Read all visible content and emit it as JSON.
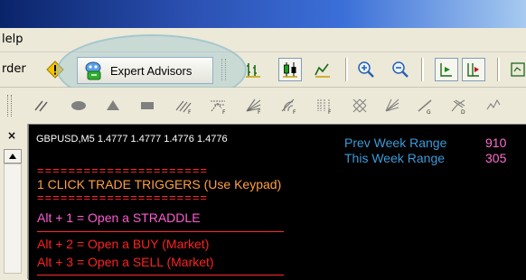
{
  "menu": {
    "help_label": "lelp"
  },
  "toolbar": {
    "order_label": "rder",
    "expert_advisors_label": "Expert Advisors"
  },
  "chart": {
    "header": "GBPUSD,M5  1.4777 1.4777 1.4776 1.4776",
    "prev_week_label": "Prev Week Range",
    "prev_week_value": "910",
    "this_week_label": "This Week Range",
    "this_week_value": "305",
    "divider_text": "======================",
    "triggers_title": "1 CLICK TRADE TRIGGERS (Use Keypad)",
    "triggers": [
      {
        "text": "Alt + 1 = Open a STRADDLE",
        "color": "#ff5ad2"
      },
      {
        "text": "Alt + 2 = Open a BUY  (Market)",
        "color": "#ff2020"
      },
      {
        "text": "Alt + 3 = Open a SELL (Market)",
        "color": "#ff2020"
      }
    ]
  },
  "colors": {
    "chart_bg": "#000000",
    "range_label": "#3a9ad9",
    "range_value": "#ff6ed0",
    "title_orange": "#ffa040",
    "divider_red": "#ff2a2a"
  }
}
